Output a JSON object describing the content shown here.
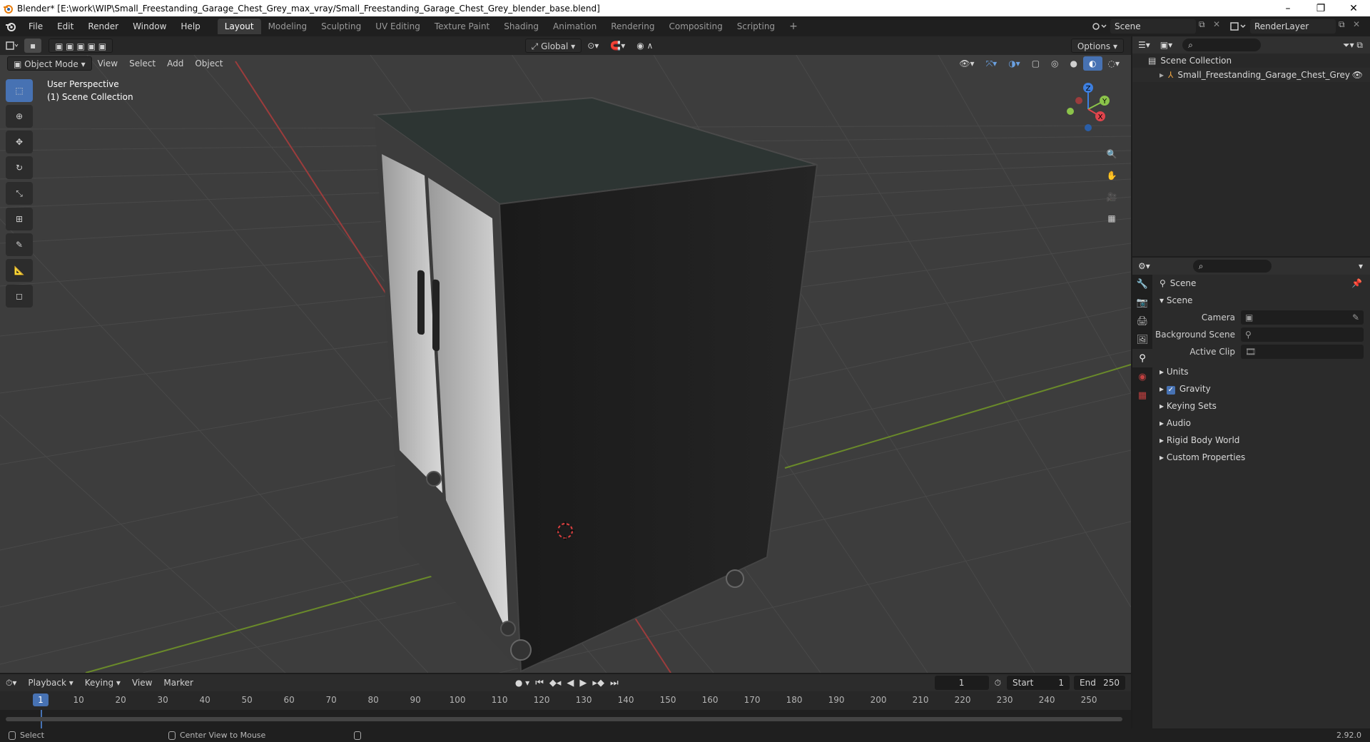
{
  "titlebar": {
    "title": "Blender* [E:\\work\\WIP\\Small_Freestanding_Garage_Chest_Grey_max_vray/Small_Freestanding_Garage_Chest_Grey_blender_base.blend]",
    "minimize": "–",
    "maximize": "❐",
    "close": "✕"
  },
  "menu": [
    "File",
    "Edit",
    "Render",
    "Window",
    "Help"
  ],
  "workspaces": [
    "Layout",
    "Modeling",
    "Sculpting",
    "UV Editing",
    "Texture Paint",
    "Shading",
    "Animation",
    "Rendering",
    "Compositing",
    "Scripting"
  ],
  "active_workspace": "Layout",
  "scene_name": "Scene",
  "render_layer": "RenderLayer",
  "viewport": {
    "mode": "Object Mode",
    "menus": [
      "View",
      "Select",
      "Add",
      "Object"
    ],
    "transform_orientation": "Global",
    "options": "Options",
    "info_line1": "User Perspective",
    "info_line2": "(1) Scene Collection",
    "gizmo_axes": [
      "X",
      "Y",
      "Z"
    ]
  },
  "outliner": {
    "root": "Scene Collection",
    "items": [
      {
        "name": "Small_Freestanding_Garage_Chest_Grey",
        "icon": "empty-icon",
        "visible": true
      }
    ]
  },
  "properties": {
    "context": "Scene",
    "section_title": "Scene",
    "fields": [
      {
        "label": "Camera",
        "value": ""
      },
      {
        "label": "Background Scene",
        "value": ""
      },
      {
        "label": "Active Clip",
        "value": ""
      }
    ],
    "subsections": [
      "Units",
      "Gravity",
      "Keying Sets",
      "Audio",
      "Rigid Body World",
      "Custom Properties"
    ],
    "gravity_checked": true,
    "tabs": [
      "tool-icon",
      "render-icon",
      "output-icon",
      "view-layer-icon",
      "scene-icon",
      "world-icon",
      "texture-icon"
    ]
  },
  "timeline": {
    "menus": [
      "Playback",
      "Keying",
      "View",
      "Marker"
    ],
    "current_frame": "1",
    "start_label": "Start",
    "start": "1",
    "end_label": "End",
    "end": "250",
    "ticks": [
      "1",
      "10",
      "20",
      "30",
      "40",
      "50",
      "60",
      "70",
      "80",
      "90",
      "100",
      "110",
      "120",
      "130",
      "140",
      "150",
      "160",
      "170",
      "180",
      "190",
      "200",
      "210",
      "220",
      "230",
      "240",
      "250"
    ]
  },
  "statusbar": {
    "select": "Select",
    "center_view": "Center View to Mouse",
    "version": "2.92.0"
  },
  "colors": {
    "accent": "#4772b3",
    "axis_x": "#e0444c",
    "axis_y": "#8bc34a",
    "axis_z": "#3d7fe0",
    "background": "#3d3d3d"
  }
}
